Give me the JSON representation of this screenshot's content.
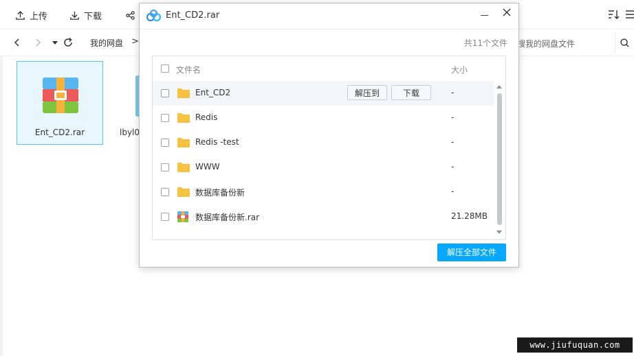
{
  "toolbar": {
    "upload": "上传",
    "download": "下载"
  },
  "navbar": {
    "crumb": "我的网盘",
    "crumb_sep": ">",
    "search_placeholder": "搜我的网盘文件"
  },
  "files": [
    {
      "name": "Ent_CD2.rar"
    },
    {
      "name": "lbyl0"
    }
  ],
  "dialog": {
    "title": "Ent_CD2.rar",
    "count": "共11个文件",
    "header": {
      "name": "文件名",
      "size": "大小"
    },
    "rows": [
      {
        "name": "Ent_CD2",
        "size": "-",
        "type": "folder",
        "extract_to": "解压到",
        "download": "下载"
      },
      {
        "name": "Redis",
        "size": "-",
        "type": "folder"
      },
      {
        "name": "Redis -test",
        "size": "-",
        "type": "folder"
      },
      {
        "name": "WWW",
        "size": "-",
        "type": "folder"
      },
      {
        "name": "数据库备份新",
        "size": "-",
        "type": "folder"
      },
      {
        "name": "数据库备份新.rar",
        "size": "21.28MB",
        "type": "rar"
      }
    ],
    "extract_all": "解压全部文件"
  },
  "watermark": "www.jiufuquan.com",
  "colors": {
    "accent": "#06a7ff",
    "folder": "#f7c242",
    "selected_tile": "#e8f6fd"
  }
}
